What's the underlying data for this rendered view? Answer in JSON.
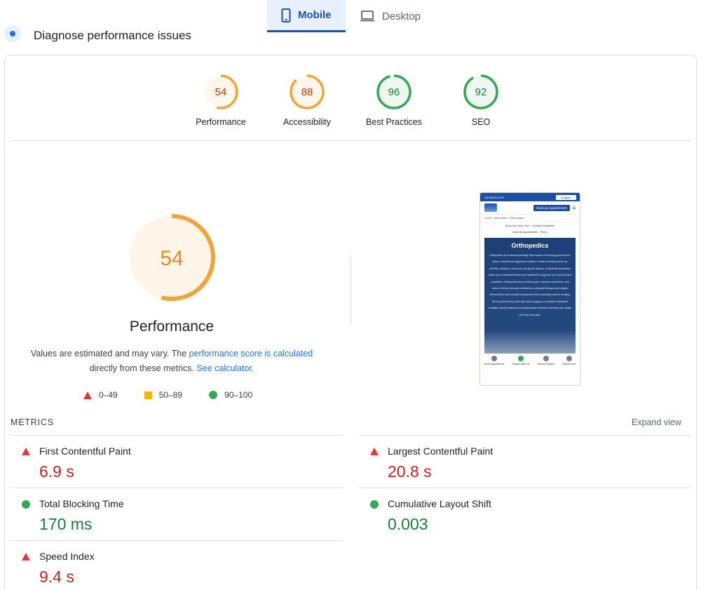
{
  "tabs": {
    "mobile": "Mobile",
    "desktop": "Desktop"
  },
  "section_title": "Diagnose performance issues",
  "scores": [
    {
      "label": "Performance",
      "value": 54,
      "level": "average"
    },
    {
      "label": "Accessibility",
      "value": 88,
      "level": "average"
    },
    {
      "label": "Best Practices",
      "value": 96,
      "level": "pass"
    },
    {
      "label": "SEO",
      "value": 92,
      "level": "pass"
    }
  ],
  "performance": {
    "score": "54",
    "label": "Performance",
    "desc_prefix": "Values are estimated and may vary. The ",
    "desc_link1": "performance score is calculated",
    "desc_middle": " directly from these metrics. ",
    "desc_link2": "See calculator.",
    "score_fraction": 0.54
  },
  "legend": {
    "fail": "0–49",
    "average": "50–89",
    "pass": "90–100"
  },
  "colors": {
    "fail": "#e53935",
    "average": "#f4b400",
    "pass": "#34a853",
    "average_text": "#c33300",
    "pass_text": "#188038",
    "accent": "#1a4fb4"
  },
  "screenshot": {
    "topbar_phone": "+48 58329 4700",
    "language": "English",
    "book_button": "Book an Appointment",
    "breadcrumb": "Home  ›  Specialities  ›  Orthopedics",
    "links_line1_a": "Bone and Joint Care",
    "links_line1_b": "Complex Surgeries",
    "links_line2_a": "Book an Appointment",
    "links_line2_b": "FAQ's",
    "hero_title": "Orthopedics",
    "hero_text": "Orthopedics is a medical specialty that focuses on keeping your bones, joints, muscles and ligaments healthy. It treats conditions such as arthritis, fractures, back pain and sports injuries. Orthopedic specialists make use of advanced tests and treatment to diagnose and correct these conditions. Orthopedist aim to reduce pain, enhance movement, and restore function through medications, physical therapy and surgical interventions such as joint replacement and minimally invasive surgery. Be it a sports injury, joint pain due to aging or a chronic orthopedic condition, timely detection and appropriate treatment will keep you active and free from pain.",
    "nav": [
      "Book Appointment",
      "Contact With Us",
      "Second Opinion",
      "Search here"
    ]
  },
  "metrics": {
    "title": "METRICS",
    "expand": "Expand view",
    "items": [
      {
        "name": "First Contentful Paint",
        "value": "6.9 s",
        "status": "fail"
      },
      {
        "name": "Largest Contentful Paint",
        "value": "20.8 s",
        "status": "fail"
      },
      {
        "name": "Total Blocking Time",
        "value": "170 ms",
        "status": "pass"
      },
      {
        "name": "Cumulative Layout Shift",
        "value": "0.003",
        "status": "pass"
      },
      {
        "name": "Speed Index",
        "value": "9.4 s",
        "status": "fail"
      }
    ]
  }
}
